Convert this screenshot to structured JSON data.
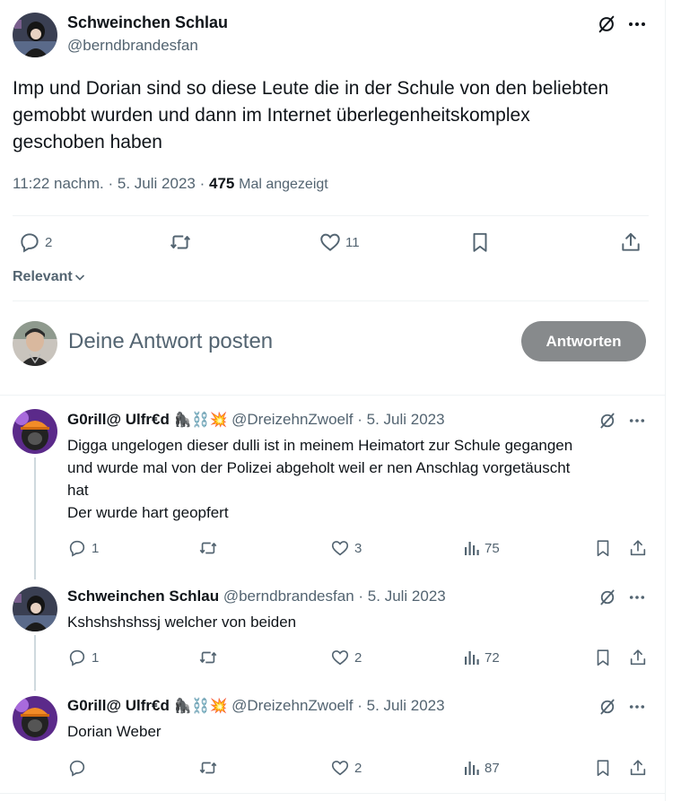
{
  "main_tweet": {
    "name": "Schweinchen Schlau",
    "handle": "@berndbrandesfan",
    "text_lines": [
      "Imp und Dorian sind so diese Leute die in der Schule von den beliebten",
      "gemobbt wurden und dann im Internet überlegenheitskomplex",
      "geschoben haben"
    ],
    "time": "11:22 nachm.",
    "date": "5. Juli 2023",
    "sep": "·",
    "views": "475",
    "views_label": "Mal angezeigt",
    "replies": "2",
    "retweets": "",
    "likes": "11"
  },
  "sort": {
    "label": "Relevant"
  },
  "composer": {
    "placeholder": "Deine Antwort posten",
    "button_label": "Antworten"
  },
  "replies": [
    {
      "name": "G0rill@ Ulfr€d",
      "emojis": "🦍⛓️💥",
      "handle": "@DreizehnZwoelf",
      "date": "5. Juli 2023",
      "sep": "·",
      "text_lines": [
        "Digga ungelogen dieser dulli ist in meinem Heimatort zur Schule gegangen",
        "und wurde mal von der Polizei abgeholt weil er nen Anschlag vorgetäuscht",
        "hat",
        "Der wurde hart geopfert"
      ],
      "replies": "1",
      "likes": "3",
      "views": "75"
    },
    {
      "name": "Schweinchen Schlau",
      "emojis": "",
      "handle": "@berndbrandesfan",
      "date": "5. Juli 2023",
      "sep": "·",
      "text_lines": [
        "Kshshshshssj welcher von beiden"
      ],
      "replies": "1",
      "likes": "2",
      "views": "72"
    },
    {
      "name": "G0rill@ Ulfr€d",
      "emojis": "🦍⛓️💥",
      "handle": "@DreizehnZwoelf",
      "date": "5. Juli 2023",
      "sep": "·",
      "text_lines": [
        "Dorian Weber"
      ],
      "replies": "",
      "likes": "2",
      "views": "87"
    }
  ],
  "colors": {
    "text": "#0f1419",
    "secondary": "#536471",
    "divider": "#eff3f4",
    "button_bg": "#878a8c",
    "thread_line": "#cfd9de"
  }
}
